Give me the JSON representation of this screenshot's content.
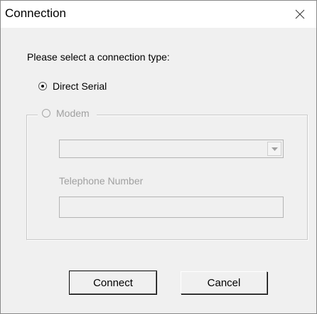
{
  "window": {
    "title": "Connection",
    "close_icon": "close-icon"
  },
  "dialog": {
    "prompt": "Please select a connection type:",
    "options": [
      {
        "label": "Direct Serial",
        "selected": true,
        "enabled": true
      },
      {
        "label": "Modem",
        "selected": false,
        "enabled": false
      }
    ],
    "modem": {
      "device_value": "",
      "telephone_label": "Telephone Number",
      "telephone_value": ""
    }
  },
  "buttons": {
    "connect": "Connect",
    "cancel": "Cancel"
  },
  "colors": {
    "window_bg": "#f0f0f0",
    "titlebar_bg": "#ffffff",
    "disabled_text": "#a0a0a0"
  }
}
